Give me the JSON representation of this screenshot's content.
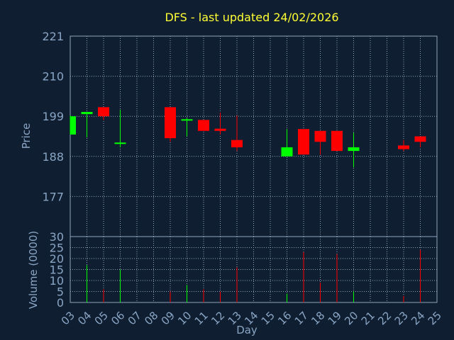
{
  "chart_data": {
    "type": "candlestick",
    "title": "DFS - last updated 24/02/2026",
    "xlabel": "Day",
    "price_ylabel": "Price",
    "volume_ylabel": "Volume (0000)",
    "days": [
      "03",
      "04",
      "05",
      "06",
      "07",
      "08",
      "09",
      "10",
      "11",
      "12",
      "13",
      "14",
      "15",
      "16",
      "17",
      "18",
      "19",
      "20",
      "21",
      "22",
      "23",
      "24",
      "25"
    ],
    "price_ticks": [
      "221",
      "210",
      "199",
      "188",
      "177"
    ],
    "price_range": [
      166,
      221
    ],
    "volume_ticks": [
      "30",
      "25",
      "20",
      "15",
      "10",
      "5",
      "0"
    ],
    "volume_range": [
      0,
      30
    ],
    "up_color": "#00ff00",
    "down_color": "#ff0000",
    "candles": [
      {
        "day": "03",
        "open": 194.0,
        "high": 199.2,
        "low": 194.0,
        "close": 199.0,
        "volume": 0
      },
      {
        "day": "04",
        "open": 199.6,
        "high": 200.2,
        "low": 193.2,
        "close": 200.2,
        "volume": 17
      },
      {
        "day": "05",
        "open": 201.5,
        "high": 201.5,
        "low": 198.0,
        "close": 199.0,
        "volume": 6
      },
      {
        "day": "06",
        "open": 191.6,
        "high": 200.8,
        "low": 190.5,
        "close": 191.8,
        "volume": 15
      },
      {
        "day": "09",
        "open": 201.5,
        "high": 201.5,
        "low": 192.0,
        "close": 193.0,
        "volume": 5
      },
      {
        "day": "10",
        "open": 198.0,
        "high": 198.5,
        "low": 193.5,
        "close": 198.2,
        "volume": 8
      },
      {
        "day": "11",
        "open": 198.0,
        "high": 198.0,
        "low": 195.0,
        "close": 195.0,
        "volume": 6
      },
      {
        "day": "12",
        "open": 195.6,
        "high": 200.0,
        "low": 194.0,
        "close": 195.0,
        "volume": 5
      },
      {
        "day": "13",
        "open": 192.5,
        "high": 199.2,
        "low": 189.5,
        "close": 190.5,
        "volume": 16
      },
      {
        "day": "16",
        "open": 188.0,
        "high": 195.5,
        "low": 188.0,
        "close": 190.5,
        "volume": 4
      },
      {
        "day": "17",
        "open": 195.5,
        "high": 195.5,
        "low": 188.5,
        "close": 188.5,
        "volume": 23
      },
      {
        "day": "18",
        "open": 195.0,
        "high": 195.0,
        "low": 188.5,
        "close": 192.0,
        "volume": 9
      },
      {
        "day": "19",
        "open": 195.0,
        "high": 195.0,
        "low": 189.5,
        "close": 189.5,
        "volume": 22
      },
      {
        "day": "20",
        "open": 189.5,
        "high": 194.5,
        "low": 185.0,
        "close": 190.5,
        "volume": 5
      },
      {
        "day": "23",
        "open": 191.0,
        "high": 192.5,
        "low": 189.5,
        "close": 190.0,
        "volume": 3
      },
      {
        "day": "24",
        "open": 193.5,
        "high": 193.5,
        "low": 190.5,
        "close": 192.0,
        "volume": 24
      }
    ]
  }
}
